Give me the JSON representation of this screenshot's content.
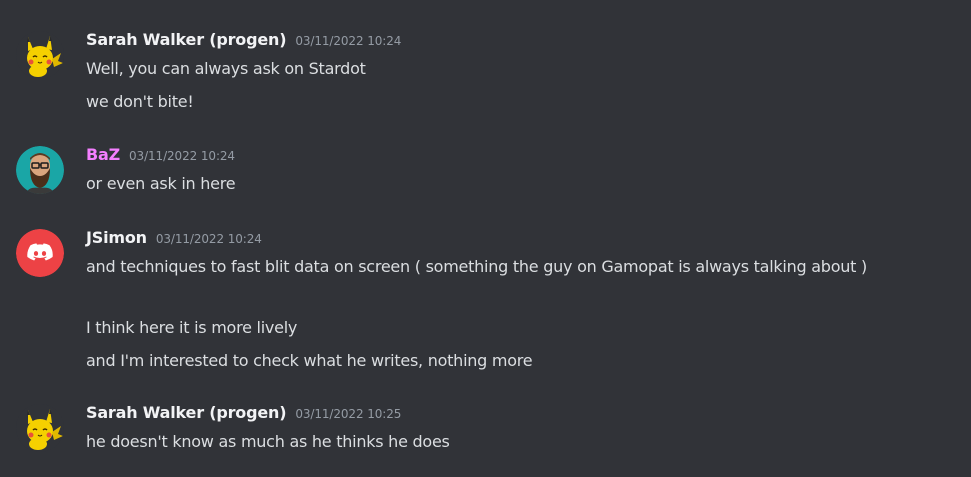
{
  "colors": {
    "background": "#313338",
    "text": "#dbdee1",
    "username_default": "#f2f3f5",
    "username_baz": "#f47fff",
    "timestamp": "#949ba4",
    "discord_blurple_avatar": "#ed4245"
  },
  "messages": [
    {
      "username": "Sarah Walker (progen)",
      "timestamp": "03/11/2022 10:24",
      "avatar_icon": "pikachu-avatar-icon",
      "lines": [
        "Well, you can always ask on Stardot",
        "we don't bite!"
      ]
    },
    {
      "username": "BaZ",
      "timestamp": "03/11/2022 10:24",
      "avatar_icon": "bearded-man-avatar-icon",
      "lines": [
        "or even ask in here"
      ]
    },
    {
      "username": "JSimon",
      "timestamp": "03/11/2022 10:24",
      "avatar_icon": "discord-default-avatar-icon",
      "lines": [
        "and techniques to fast blit data on screen ( something the guy on Gamopat is always talking about )",
        "I think here it is more lively",
        "and I'm interested to check what he writes, nothing more"
      ]
    },
    {
      "username": "Sarah Walker (progen)",
      "timestamp": "03/11/2022 10:25",
      "avatar_icon": "pikachu-avatar-icon",
      "lines": [
        "he doesn't know as much as he thinks he does"
      ]
    }
  ]
}
